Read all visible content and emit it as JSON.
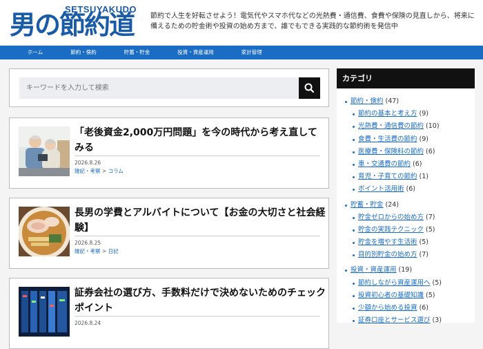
{
  "site": {
    "name_kanji": "男の節約道",
    "name_romaji": "SETSUYAKUDO",
    "tagline": "節約で人生を好転させよう！電気代やスマホ代などの光熱費・通信費、食費や保険の見直しから、将来に備えるための貯金術や投資の始め方まで、誰でもできる実践的な節約術を発信中"
  },
  "nav": [
    "ホーム",
    "節約・倹約",
    "貯蓄・貯金",
    "投資・資産運用",
    "家計管理"
  ],
  "search": {
    "placeholder": "キーワードを入力して検索"
  },
  "articles": [
    {
      "title": "「老後資金2,000万円問題」を今の時代から考え直してみる",
      "date": "2026.8.26",
      "cat1": "雑記・考察",
      "sep": ">",
      "cat2": "コラム"
    },
    {
      "title": "長男の学費とアルバイトについて【お金の大切さと社会経験】",
      "date": "2026.8.25",
      "cat1": "雑記・考察",
      "sep": ">",
      "cat2": "日記"
    },
    {
      "title": "証券会社の選び方、手数料だけで決めないためのチェックポイント",
      "date": "2026.8.24",
      "cat1": "",
      "sep": "",
      "cat2": ""
    }
  ],
  "sidebar": {
    "heading": "カテゴリ",
    "categories": [
      {
        "name": "節約・倹約",
        "count": "(47)",
        "level": 0
      },
      {
        "name": "節約の基本と考え方",
        "count": "(9)",
        "level": 1
      },
      {
        "name": "光熱費・通信費の節約",
        "count": "(10)",
        "level": 1
      },
      {
        "name": "食費・生活費の節約",
        "count": "(9)",
        "level": 1
      },
      {
        "name": "医療費・保険料の節約",
        "count": "(6)",
        "level": 1
      },
      {
        "name": "車・交通費の節約",
        "count": "(6)",
        "level": 1
      },
      {
        "name": "育児・子育ての節約",
        "count": "(1)",
        "level": 1
      },
      {
        "name": "ポイント活用術",
        "count": "(6)",
        "level": 1
      },
      {
        "name": "貯蓄・貯金",
        "count": "(24)",
        "level": 0
      },
      {
        "name": "貯金ゼロからの始め方",
        "count": "(7)",
        "level": 1
      },
      {
        "name": "貯金の実践テクニック",
        "count": "(5)",
        "level": 1
      },
      {
        "name": "貯金を増やす生活術",
        "count": "(5)",
        "level": 1
      },
      {
        "name": "目的別貯金の始め方",
        "count": "(7)",
        "level": 1
      },
      {
        "name": "投資・資産運用",
        "count": "(19)",
        "level": 0
      },
      {
        "name": "節約しながら資産運用へ",
        "count": "(5)",
        "level": 1
      },
      {
        "name": "投資初心者の基礎知識",
        "count": "(5)",
        "level": 1
      },
      {
        "name": "少額から始める投資",
        "count": "(6)",
        "level": 1
      },
      {
        "name": "証券口座とサービス選び",
        "count": "(3)",
        "level": 1
      }
    ]
  },
  "colors": {
    "brand": "#1a5ba8",
    "nav_bg": "#1a6cc4",
    "link": "#1a6cc4",
    "sidebar_head": "#111111"
  }
}
